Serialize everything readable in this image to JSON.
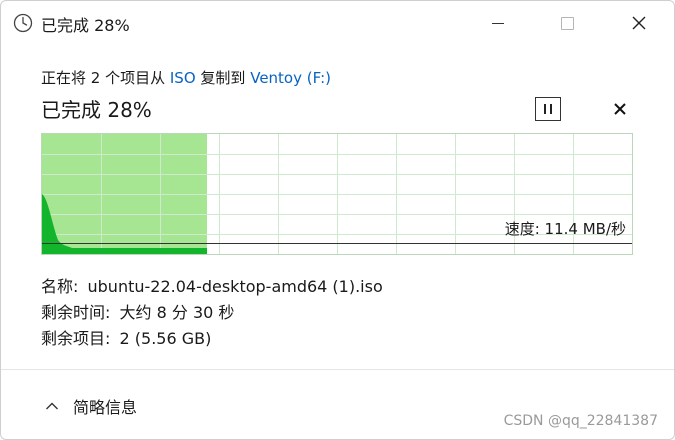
{
  "window": {
    "title": "已完成 28%",
    "controls": {
      "minimize": "minimize",
      "maximize": "maximize",
      "close": "close"
    }
  },
  "operation": {
    "prefix": "正在将 2 个项目从",
    "source": "ISO",
    "middle": "复制到",
    "destination": "Ventoy (F:)"
  },
  "status": {
    "percent_text": "已完成 28%",
    "progress_fraction": 0.28
  },
  "graph": {
    "speed_label": "速度: 11.4 MB/秒",
    "colors": {
      "completed_fill": "#a6e591",
      "curve_fill": "#13b52d",
      "grid": "#cfe9cf",
      "speed_line": "#333333"
    }
  },
  "details": {
    "name_label": "名称:",
    "name_value": "ubuntu-22.04-desktop-amd64 (1).iso",
    "time_label": "剩余时间:",
    "time_value": "大约 8 分 30 秒",
    "items_label": "剩余项目:",
    "items_value": "2 (5.56 GB)"
  },
  "footer": {
    "toggle_label": "简略信息"
  },
  "watermark": "CSDN @qq_22841387",
  "icons": {
    "title": "clock-icon",
    "pause": "pause-icon",
    "cancel": "close-icon",
    "toggle": "chevron-up-icon"
  }
}
